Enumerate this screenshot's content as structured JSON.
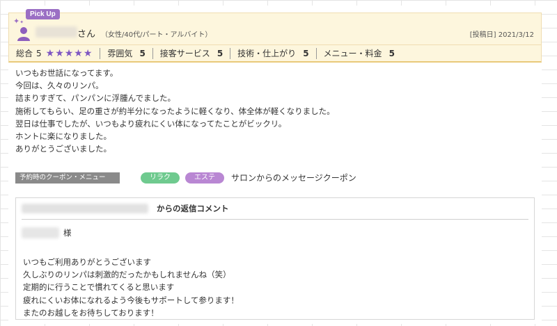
{
  "review": {
    "pickup_label": "Pick Up",
    "reviewer_suffix": "さん",
    "reviewer_meta": "（女性/40代/パート・アルバイト）",
    "post_date": "[投稿日] 2021/3/12",
    "ratings": {
      "overall_label": "総合",
      "overall_value": "5",
      "stars": "★★★★★",
      "stars_count": 5,
      "items": [
        {
          "label": "雰囲気",
          "value": "5"
        },
        {
          "label": "接客サービス",
          "value": "5"
        },
        {
          "label": "技術・仕上がり",
          "value": "5"
        },
        {
          "label": "メニュー・料金",
          "value": "5"
        }
      ]
    },
    "body_lines": [
      "いつもお世話になってます。",
      "今回は、久々のリンパ。",
      "詰まりすぎて、パンパンに浮腫んでました。",
      "施術してもらい、足の重さが約半分になったように軽くなり、体全体が軽くなりました。",
      "翌日は仕事でしたが、いつもより疲れにくい体になってたことがビックリ。",
      "ホントに楽になりました。",
      "ありがとうございました。"
    ]
  },
  "coupon": {
    "tag_label": "予約時のクーポン・メニュー",
    "chip_1": "リラク",
    "chip_2": "エステ",
    "coupon_name": "サロンからのメッセージクーポン"
  },
  "reply": {
    "title_suffix": "からの返信コメント",
    "addressee_suffix": "様",
    "body_lines": [
      "いつもご利用ありがとうございます",
      "久しぶりのリンパは刺激的だったかもしれませんね（笑）",
      "定期的に行うことで慣れてくると思います",
      "疲れにくいお体になれるよう今後もサポートして参ります！",
      "またのお越しをお待ちしております！"
    ]
  },
  "colors": {
    "header_bg": "#fdf6dd",
    "accent_purple": "#9b6fc4",
    "star_color": "#7e57c2",
    "chip_green": "#6fca8f",
    "chip_purple": "#b987d3"
  }
}
